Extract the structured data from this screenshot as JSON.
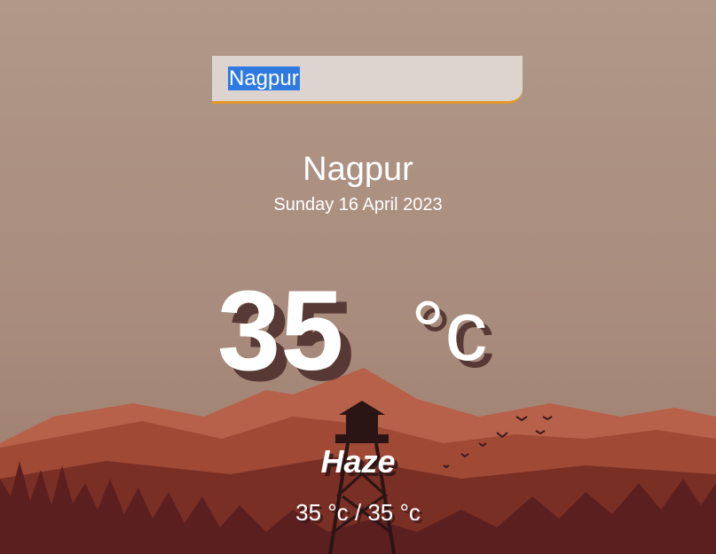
{
  "search": {
    "value": "Nagpur"
  },
  "location": {
    "city": "Nagpur",
    "date": "Sunday 16 April 2023"
  },
  "current": {
    "temperature": "35",
    "unit": "°c",
    "condition": "Haze",
    "hi_low": "35 °c / 35 °c"
  },
  "colors": {
    "search_underline": "#e39a2b",
    "selection": "#2f7ae0",
    "text": "#ffffff"
  }
}
